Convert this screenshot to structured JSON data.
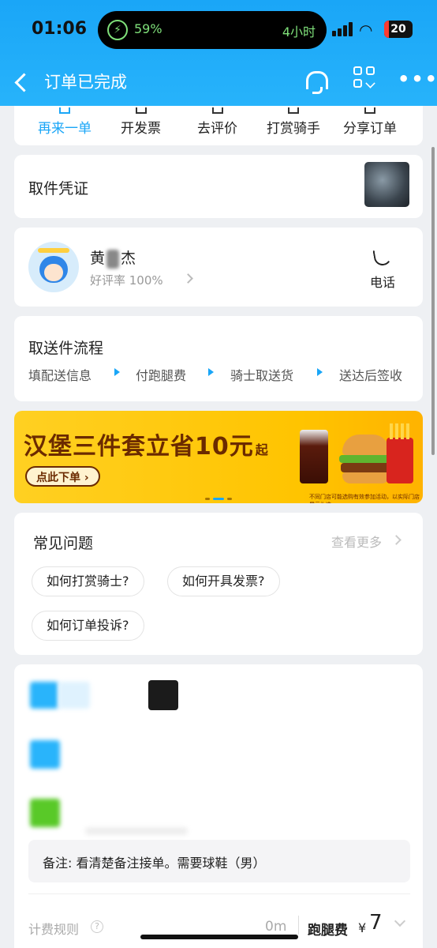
{
  "status": {
    "time": "01:06",
    "battery_pct": "59%",
    "hours": "4小时",
    "battery_level": "20",
    "icons": [
      "bolt-icon",
      "signal-icon",
      "wifi-icon",
      "battery-icon"
    ]
  },
  "header": {
    "title": "订单已完成",
    "icons": [
      "back-icon",
      "headset-icon",
      "mini-program-icon",
      "more-icon"
    ]
  },
  "actions": [
    "再来一单",
    "开发票",
    "去评价",
    "打赏骑手",
    "分享订单"
  ],
  "pickup": {
    "label": "取件凭证"
  },
  "rider": {
    "name_first": "黄",
    "name_last": "杰",
    "rating": "好评率 100%",
    "phone_label": "电话"
  },
  "flow": {
    "title": "取送件流程",
    "steps": [
      "填配送信息",
      "付跑腿费",
      "骑士取送货",
      "送达后签收"
    ]
  },
  "banner": {
    "headline": "汉堡三件套立省10元",
    "suffix": "起",
    "button": "点此下单 ›",
    "fineprint": "不同门店可能选购有效参加活动，以实际门店展示为准"
  },
  "faq": {
    "title": "常见问题",
    "more": "查看更多",
    "questions": [
      "如何打赏骑士?",
      "如何开具发票?",
      "如何订单投诉?"
    ]
  },
  "order": {
    "note": "备注: 看清楚备注接单。需要球鞋（男）",
    "fee_rule": "计费规则",
    "distance": "0m",
    "fee_name": "跑腿费",
    "currency": "¥",
    "fee_value": "7"
  },
  "colors": {
    "brand": "#1aa6f7",
    "banner": "#ffc400",
    "banner_text": "#6b2a00"
  }
}
